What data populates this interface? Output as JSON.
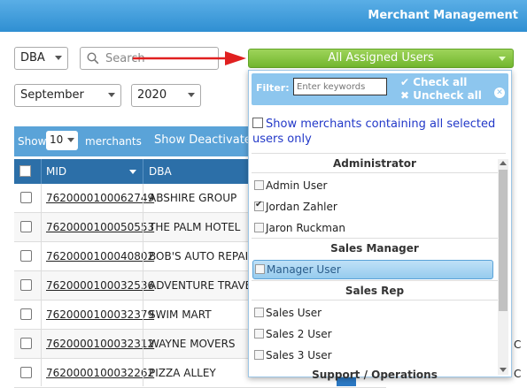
{
  "header": {
    "title": "Merchant Management"
  },
  "filters": {
    "field": "DBA",
    "search_placeholder": "Search",
    "month": "September",
    "year": "2020",
    "assigned": "All Assigned Users"
  },
  "table": {
    "show_label": "Show",
    "entries": "10",
    "entries_suffix": "merchants",
    "deactivated": "Show Deactivated",
    "col_mid": "MID",
    "col_dba": "DBA",
    "rows": [
      {
        "mid": "7620000100062749",
        "dba": "ABSHIRE GROUP"
      },
      {
        "mid": "7620000100050553",
        "dba": "THE PALM HOTEL"
      },
      {
        "mid": "7620000100040802",
        "dba": "BOB'S AUTO REPAIR"
      },
      {
        "mid": "7620000100032536",
        "dba": "ADVENTURE TRAVEL"
      },
      {
        "mid": "7620000100032379",
        "dba": "SWIM MART"
      },
      {
        "mid": "7620000100032312",
        "dba": "WAYNE MOVERS"
      },
      {
        "mid": "7620000100032262",
        "dba": "PIZZA ALLEY"
      }
    ],
    "cut_c": "C"
  },
  "dropdown": {
    "filter_label": "Filter:",
    "filter_placeholder": "Enter keywords",
    "check_all": "Check all",
    "uncheck_all": "Uncheck all",
    "show_all_text": "Show merchants containing all selected users only",
    "groups": {
      "administrator": "Administrator",
      "sales_manager": "Sales Manager",
      "sales_rep": "Sales Rep",
      "support": "Support / Operations"
    },
    "options": {
      "admin_user": "Admin User",
      "jordan": "Jordan Zahler",
      "jaron": "Jaron Ruckman",
      "manager": "Manager User",
      "sales": "Sales User",
      "sales2": "Sales 2 User",
      "sales3": "Sales 3 User"
    },
    "checked": {
      "jordan": true
    }
  },
  "colors": {
    "accent": "#2f8fd2",
    "green": "#72b62e",
    "arrow": "#e02020"
  }
}
